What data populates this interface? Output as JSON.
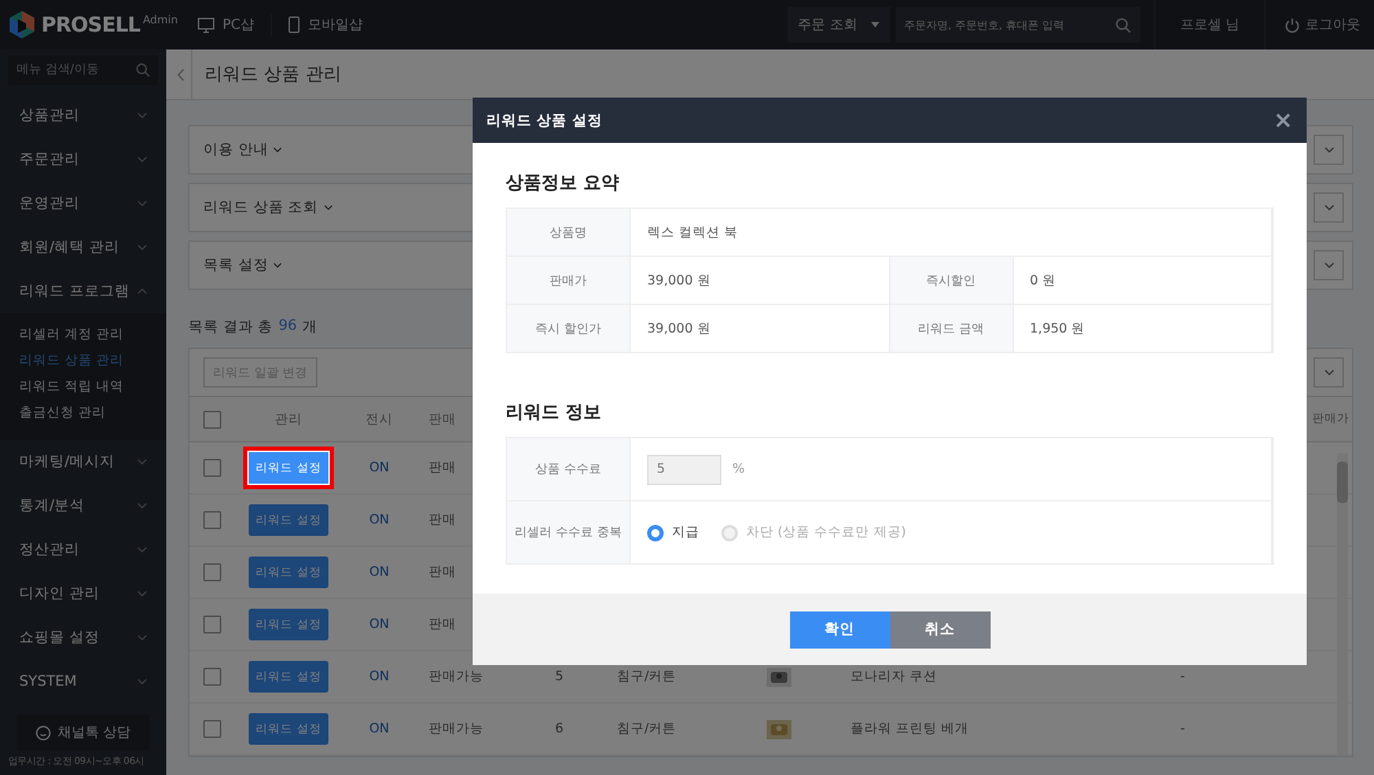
{
  "topbar": {
    "logo": "PROSELL",
    "logo_sub": "Admin",
    "links": [
      {
        "kind": "desktop",
        "label": "PC샵"
      },
      {
        "kind": "mobile",
        "label": "모바일샵"
      }
    ],
    "search_select": "주문 조회",
    "search_placeholder": "주문자명, 주문번호, 휴대폰 입력",
    "user": "프로셀 님",
    "logout": "로그아웃"
  },
  "sidebar": {
    "search_placeholder": "메뉴 검색/이동",
    "items": [
      {
        "label": "상품관리",
        "expanded": false
      },
      {
        "label": "주문관리",
        "expanded": false
      },
      {
        "label": "운영관리",
        "expanded": false
      },
      {
        "label": "회원/혜택 관리",
        "expanded": false
      },
      {
        "label": "리워드 프로그램",
        "expanded": true,
        "children": [
          {
            "label": "리셀러 계정 관리",
            "selected": false
          },
          {
            "label": "리워드 상품 관리",
            "selected": true
          },
          {
            "label": "리워드 적립 내역",
            "selected": false
          },
          {
            "label": "출금신청 관리",
            "selected": false
          }
        ]
      },
      {
        "label": "마케팅/메시지",
        "expanded": false
      },
      {
        "label": "통계/분석",
        "expanded": false
      },
      {
        "label": "정산관리",
        "expanded": false
      },
      {
        "label": "디자인 관리",
        "expanded": false
      },
      {
        "label": "쇼핑몰 설정",
        "expanded": false
      },
      {
        "label": "SYSTEM",
        "expanded": false
      }
    ],
    "consult": "채널톡 상담",
    "hours": "업무시간 : 오전 09시~오후 06시"
  },
  "page": {
    "title": "리워드 상품 관리",
    "panels": [
      "이용 안내",
      "리워드 상품 조회",
      "목록 설정"
    ],
    "result_prefix": "목록 결과 총",
    "result_count": "96",
    "result_suffix": "개",
    "bulk_button": "리워드 일괄 변경",
    "table": {
      "all_checked": false,
      "columns": [
        "관리",
        "전시",
        "판매",
        "판매가"
      ],
      "rows": [
        {
          "checked": false,
          "action": "리워드 설정",
          "highlighted": true,
          "display": "ON",
          "status": "판매"
        },
        {
          "checked": false,
          "action": "리워드 설정",
          "highlighted": false,
          "display": "ON",
          "status": "판매"
        },
        {
          "checked": false,
          "action": "리워드 설정",
          "highlighted": false,
          "display": "ON",
          "status": "판매"
        },
        {
          "checked": false,
          "action": "리워드 설정",
          "highlighted": false,
          "display": "ON",
          "status": "판매"
        },
        {
          "checked": false,
          "action": "리워드 설정",
          "highlighted": false,
          "display": "ON",
          "status": "판매가능",
          "number": "5",
          "category": "침구/커튼",
          "name": "모나리자 쿠션",
          "extra": "-"
        },
        {
          "checked": false,
          "action": "리워드 설정",
          "highlighted": false,
          "display": "ON",
          "status": "판매가능",
          "number": "6",
          "category": "침구/커튼",
          "name": "플라워 프린팅 베개",
          "extra": "-"
        }
      ]
    }
  },
  "modal": {
    "title": "리워드 상품 설정",
    "close": "×",
    "summary_title": "상품정보 요약",
    "summary_rows": [
      [
        {
          "label": "상품명",
          "value": "렉스 컬렉션 북"
        }
      ],
      [
        {
          "label": "판매가",
          "value": "39,000 원"
        },
        {
          "label": "즉시할인",
          "value": "0 원"
        }
      ],
      [
        {
          "label": "즉시 할인가",
          "value": "39,000 원"
        },
        {
          "label": "리워드 금액",
          "value": "1,950 원"
        }
      ]
    ],
    "reward_title": "리워드 정보",
    "commission": {
      "label": "상품 수수료",
      "value": "5",
      "unit": "%",
      "disabled": true
    },
    "overlap": {
      "label": "리셀러 수수료 중복",
      "options": [
        {
          "label": "지급",
          "selected": true,
          "disabled": false
        },
        {
          "label": "차단 (상품 수수료만 제공)",
          "selected": false,
          "disabled": true
        }
      ]
    },
    "buttons": [
      {
        "kind": "primary",
        "label": "확인"
      },
      {
        "kind": "secondary",
        "label": "취소"
      }
    ]
  }
}
